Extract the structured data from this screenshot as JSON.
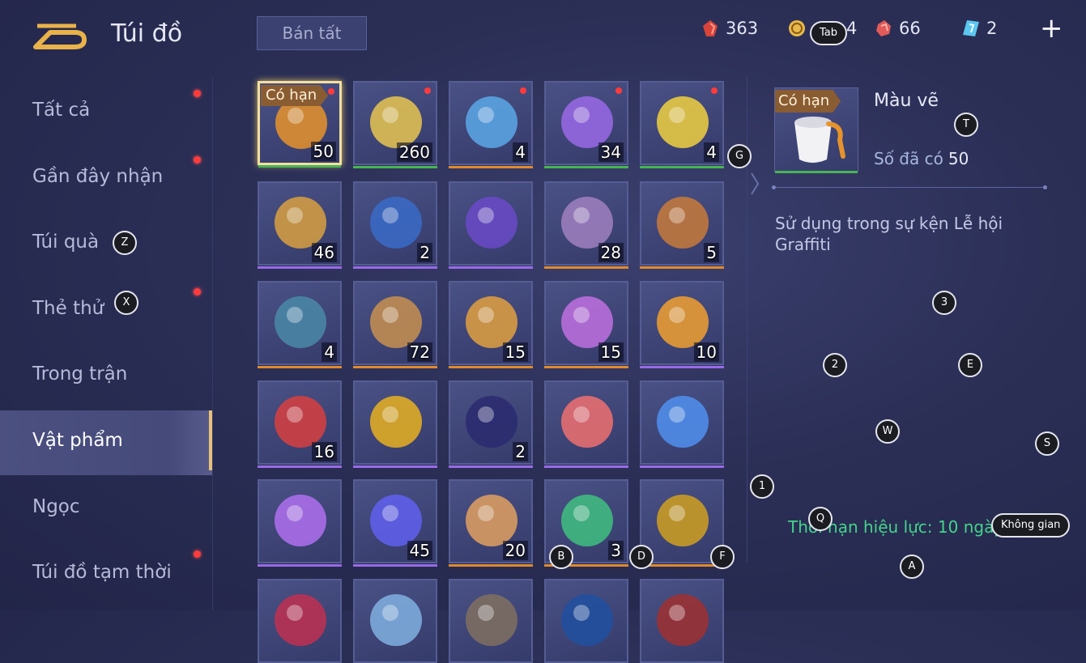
{
  "header": {
    "title": "Túi đồ",
    "sell_all_label": "Bán tất",
    "currencies": [
      {
        "icon": "red-gem-icon",
        "value": "363"
      },
      {
        "icon": "gold-coin-icon",
        "value": "4"
      },
      {
        "icon": "red-crystal-icon",
        "value": "66"
      },
      {
        "icon": "ticket-icon",
        "value": "2"
      }
    ],
    "plus_label": "+"
  },
  "sidebar": {
    "items": [
      {
        "label": "Tất cả",
        "dot": true
      },
      {
        "label": "Gần đây nhận",
        "dot": true
      },
      {
        "label": "Túi quà",
        "dot": false
      },
      {
        "label": "Thẻ thử",
        "dot": true
      },
      {
        "label": "Trong trận",
        "dot": false
      },
      {
        "label": "Vật phẩm",
        "dot": false,
        "active": true
      },
      {
        "label": "Ngọc",
        "dot": false
      },
      {
        "label": "Túi đồ tạm thời",
        "dot": true
      }
    ]
  },
  "grid": {
    "limited_label": "Có hạn",
    "items": [
      {
        "icon": "paint-bucket-icon",
        "qty": "50",
        "quality": "green",
        "dot": true,
        "limited": true,
        "selected": true
      },
      {
        "icon": "gold-ticket-icon",
        "qty": "260",
        "quality": "green",
        "dot": true
      },
      {
        "icon": "rocket-icon",
        "qty": "4",
        "quality": "orange",
        "dot": true
      },
      {
        "icon": "dice-icon",
        "qty": "34",
        "quality": "green",
        "dot": true
      },
      {
        "icon": "lightning-icon",
        "qty": "4",
        "quality": "green",
        "dot": true
      },
      {
        "icon": "compass-trophy-icon",
        "qty": "46",
        "quality": "purple"
      },
      {
        "icon": "exp-x2-card-icon",
        "qty": "2",
        "quality": "purple"
      },
      {
        "icon": "purple-card-icon",
        "qty": "",
        "quality": "purple"
      },
      {
        "icon": "helmet-icon",
        "qty": "28",
        "quality": "orange"
      },
      {
        "icon": "armor-icon",
        "qty": "5",
        "quality": "orange"
      },
      {
        "icon": "scroll-map-icon",
        "qty": "4",
        "quality": "orange"
      },
      {
        "icon": "scroll-icon",
        "qty": "72",
        "quality": "orange"
      },
      {
        "icon": "hero-shard-icon",
        "qty": "15",
        "quality": "orange"
      },
      {
        "icon": "puzzle-icon",
        "qty": "15",
        "quality": "orange"
      },
      {
        "icon": "wave-logo-icon",
        "qty": "10",
        "quality": "purple"
      },
      {
        "icon": "star-badge-icon",
        "qty": "16",
        "quality": "purple"
      },
      {
        "icon": "sting-logo-icon",
        "qty": "",
        "quality": "purple"
      },
      {
        "icon": "mykolor-logo-icon",
        "qty": "2",
        "quality": "purple"
      },
      {
        "icon": "n1-badge-icon",
        "qty": "",
        "quality": "purple"
      },
      {
        "icon": "n2-badge-icon",
        "qty": "",
        "quality": "purple"
      },
      {
        "icon": "n3-badge-icon",
        "qty": "",
        "quality": "purple"
      },
      {
        "icon": "orb-crosshair-icon",
        "qty": "45",
        "quality": "purple"
      },
      {
        "icon": "hero-shard-2-icon",
        "qty": "20",
        "quality": "orange"
      },
      {
        "icon": "exit-door-icon",
        "qty": "3",
        "quality": "orange"
      },
      {
        "icon": "star-medal-icon",
        "qty": "",
        "quality": "orange"
      },
      {
        "icon": "rose-icon",
        "qty": "",
        "quality": "none"
      },
      {
        "icon": "crystal-icon",
        "qty": "",
        "quality": "none"
      },
      {
        "icon": "cat-badge-icon",
        "qty": "",
        "quality": "none"
      },
      {
        "icon": "blue-card-icon",
        "qty": "",
        "quality": "none"
      },
      {
        "icon": "red-card-icon",
        "qty": "",
        "quality": "none"
      }
    ]
  },
  "detail": {
    "limited_label": "Có hạn",
    "name": "Màu vẽ",
    "owned_label": "Số đã có",
    "owned_value": "50",
    "description": "Sử dụng trong sự kện Lễ hội Graffiti",
    "expiry": "Thời hạn hiệu lực: 10 ngày"
  },
  "key_hints": [
    {
      "key": "Tab"
    },
    {
      "key": "G"
    },
    {
      "key": "T"
    },
    {
      "key": "Z"
    },
    {
      "key": "X"
    },
    {
      "key": "3"
    },
    {
      "key": "2"
    },
    {
      "key": "E"
    },
    {
      "key": "W"
    },
    {
      "key": "S"
    },
    {
      "key": "1"
    },
    {
      "key": "Q"
    },
    {
      "key": "Không gian"
    },
    {
      "key": "A"
    },
    {
      "key": "B"
    },
    {
      "key": "D"
    },
    {
      "key": "F"
    }
  ],
  "colors": {
    "quality_green": "#47b552",
    "quality_orange": "#e08a2c",
    "quality_purple": "#9a6ae8",
    "accent_gold": "#e8c27a",
    "expire_green": "#43d48a",
    "red_dot": "#ff3b3b"
  }
}
